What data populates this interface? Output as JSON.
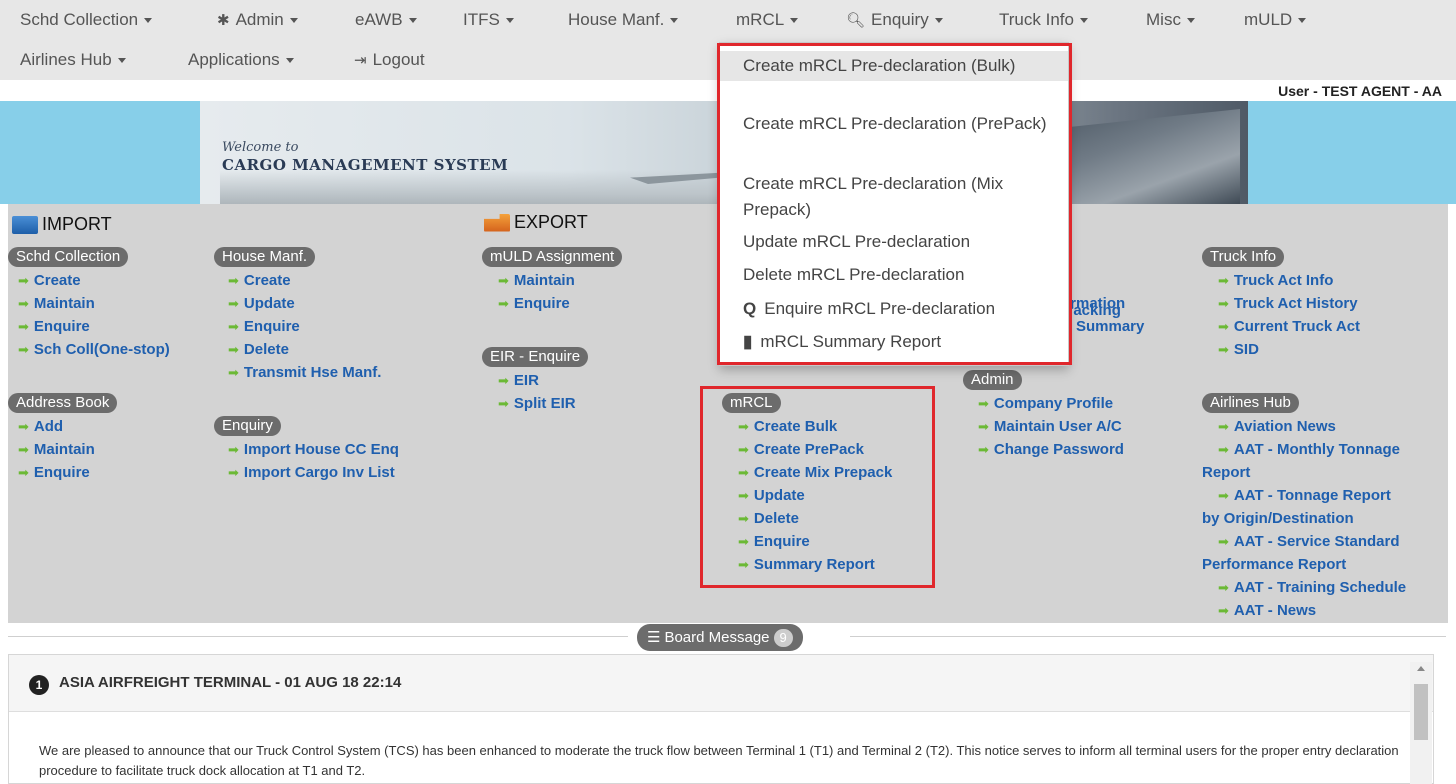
{
  "navbar": {
    "row1": [
      {
        "label": "Schd Collection",
        "icon": ""
      },
      {
        "label": "Admin",
        "icon": "gear-icon"
      },
      {
        "label": "eAWB",
        "icon": ""
      },
      {
        "label": "ITFS",
        "icon": ""
      },
      {
        "label": "House Manf.",
        "icon": ""
      },
      {
        "label": "mRCL",
        "icon": ""
      },
      {
        "label": "Enquiry",
        "icon": "search-icon"
      },
      {
        "label": "Truck Info",
        "icon": ""
      },
      {
        "label": "Misc",
        "icon": ""
      },
      {
        "label": "mULD",
        "icon": ""
      }
    ],
    "row2": [
      {
        "label": "Airlines Hub",
        "icon": ""
      },
      {
        "label": "Applications",
        "icon": ""
      },
      {
        "label": "Logout",
        "icon": "sign-out-icon"
      }
    ]
  },
  "user_label": "User - TEST AGENT - AA",
  "banner": {
    "welcome": "Welcome to",
    "title": "CARGO MANAGEMENT SYSTEM"
  },
  "mrcl_dropdown": [
    "Create mRCL Pre-declaration (Bulk)",
    "Create mRCL Pre-declaration (PrePack)",
    "Create mRCL Pre-declaration (Mix Prepack)",
    "Update mRCL Pre-declaration",
    "Delete mRCL Pre-declaration",
    "Enquire mRCL Pre-declaration",
    "mRCL Summary Report"
  ],
  "import": {
    "heading": "IMPORT",
    "schd_collection": {
      "label": "Schd Collection",
      "links": [
        "Create",
        "Maintain",
        "Enquire",
        "Sch Coll(One-stop)"
      ]
    },
    "address_book": {
      "label": "Address Book",
      "links": [
        "Add",
        "Maintain",
        "Enquire"
      ]
    },
    "house_manf": {
      "label": "House Manf.",
      "links": [
        "Create",
        "Update",
        "Enquire",
        "Delete",
        "Transmit Hse Manf."
      ]
    },
    "enquiry": {
      "label": "Enquiry",
      "links": [
        "Import House CC Enq",
        "Import Cargo Inv List"
      ]
    }
  },
  "export": {
    "heading": "EXPORT",
    "muld_assignment": {
      "label": "mULD Assignment",
      "links": [
        "Maintain",
        "Enquire"
      ]
    },
    "eir_enquire": {
      "label": "EIR - Enquire",
      "links": [
        "EIR",
        "Split EIR"
      ]
    },
    "mrcl": {
      "label": "mRCL",
      "links": [
        "Create Bulk",
        "Create PrePack",
        "Create Mix Prepack",
        "Update",
        "Delete",
        "Enquire",
        "Summary Report"
      ]
    }
  },
  "misc_col": {
    "partial_links": [
      "t Tracking",
      "formation",
      "Summary"
    ],
    "admin": {
      "label": "Admin",
      "links": [
        "Company Profile",
        "Maintain User A/C",
        "Change Password"
      ]
    }
  },
  "truck_info": {
    "label": "Truck Info",
    "links": [
      "Truck Act Info",
      "Truck Act History",
      "Current Truck Act",
      "SID"
    ]
  },
  "airlines_hub": {
    "label": "Airlines Hub",
    "links": {
      "aviation_news": "Aviation News",
      "monthly_tonnage_a": "AAT - Monthly Tonnage",
      "monthly_tonnage_b": "Report",
      "tonnage_origin_a": "AAT - Tonnage Report",
      "tonnage_origin_b": "by Origin/Destination",
      "service_std_a": "AAT - Service Standard",
      "service_std_b": "Performance Report",
      "training": "AAT - Training Schedule",
      "news": "AAT - News"
    }
  },
  "board": {
    "label": "Board Message",
    "count": "9",
    "message": {
      "number": "1",
      "title": "ASIA AIRFREIGHT TERMINAL - 01 AUG 18 22:14",
      "body": "We are pleased to announce that our Truck Control System (TCS) has been enhanced to moderate the truck flow between Terminal 1 (T1) and Terminal 2 (T2). This notice serves to inform all terminal users for the proper entry declaration procedure to facilitate truck dock allocation at T1 and T2."
    }
  },
  "colors": {
    "accent_link": "#1f5fae",
    "highlight_red": "#e0272c",
    "pill_grey": "#6c6c6c"
  }
}
